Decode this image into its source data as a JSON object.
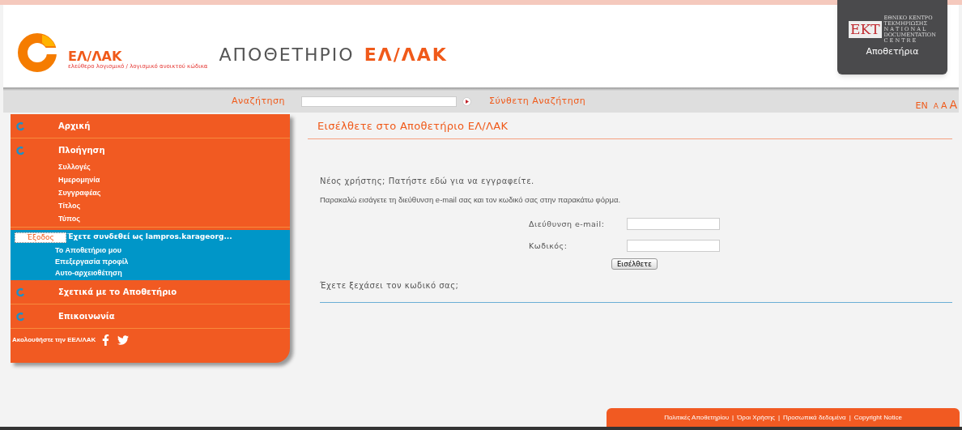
{
  "header": {
    "logo_name": "ΕΛ/ΛΑΚ",
    "logo_tagline": "ελεύθερο λογισμικό / λογισμικό ανοικτού κώδικα",
    "title_main": "ΑΠΟΘΕΤΗΡΙΟ",
    "title_accent": "ΕΛ/ΛΑΚ",
    "badge": {
      "letters": "EKT",
      "line_1": "ΕΘΝΙΚΟ ΚΕΝΤΡΟ",
      "line_2": "ΤΕΚΜΗΡΙΩΣΗΣ",
      "line_3": "N A T I O N A L",
      "line_4": "DOCUMENTATION",
      "line_5": "C E N T R E",
      "caption": "Αποθετήρια"
    }
  },
  "search_bar": {
    "label": "Αναζήτηση",
    "advanced": "Σύνθετη Αναζήτηση",
    "language": "EN",
    "font_sizes": [
      "A",
      "A",
      "A"
    ]
  },
  "sidebar": {
    "sections": [
      {
        "kind": "main",
        "label": "Αρχική"
      },
      {
        "kind": "main",
        "label": "Πλοήγηση",
        "children": [
          {
            "label": "Συλλογές"
          },
          {
            "label": "Ημερομηνία"
          },
          {
            "label": "Συγγραφέας"
          },
          {
            "label": "Τίτλος"
          },
          {
            "label": "Τύπος"
          }
        ]
      },
      {
        "kind": "account",
        "logout": "Έξοδος",
        "status": "Έχετε συνδεθεί ως lampros.karageorg...",
        "links": [
          {
            "label": "Το Αποθετήριο μου"
          },
          {
            "label": "Επεξεργασία προφίλ"
          },
          {
            "label": "Αυτο-αρχειοθέτηση"
          }
        ]
      },
      {
        "kind": "main",
        "label": "Σχετικά με το Αποθετήριο"
      },
      {
        "kind": "main",
        "label": "Επικοινωνία"
      }
    ],
    "follow": "Ακολουθήστε την ΕΕΛ/ΛΑΚ"
  },
  "main": {
    "heading": "Εισέλθετε στο Αποθετήριο ΕΛ/ΛΑΚ",
    "register": "Νέος χρήστης; Πατήστε εδώ για να εγγραφείτε.",
    "instructions": "Παρακαλώ εισάγετε τη διεύθυνση e-mail σας και τον κωδικό σας στην παρακάτω φόρμα.",
    "fields": [
      {
        "label": "Διεύθυνση e-mail:"
      },
      {
        "label": "Κωδικός:"
      }
    ],
    "submit": "Εισέλθετε",
    "forgot": "Έχετε ξεχάσει τον κωδικό σας;"
  },
  "footer": {
    "separator": "|",
    "links": [
      "Πολιτικές Αποθετηρίου",
      "Όροι Χρήσης",
      "Προσωπικά δεδομένα",
      "Copyright Notice"
    ]
  }
}
